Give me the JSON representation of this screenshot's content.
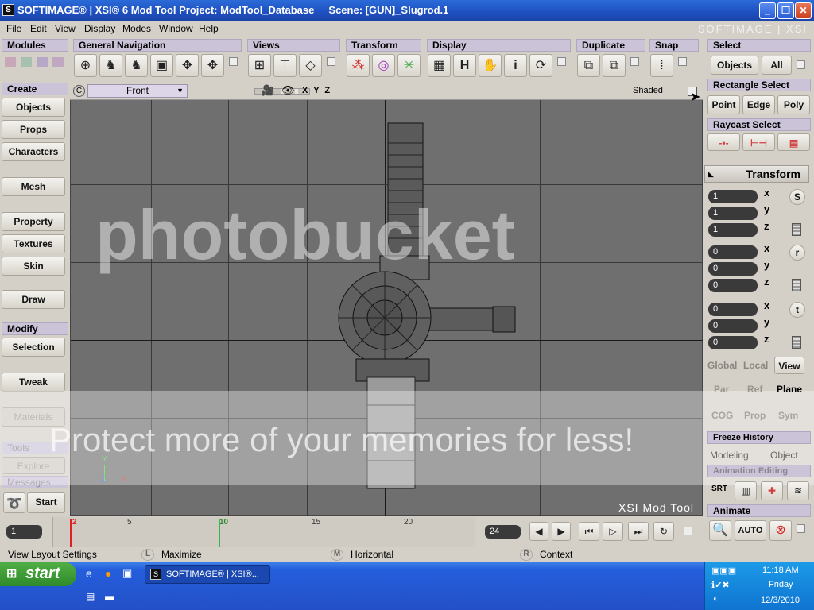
{
  "title_bar": {
    "title": "SOFTIMAGE® | XSI® 6 Mod Tool Project: ModTool_Database     Scene: [GUN]_Slugrod.1",
    "icon": "S"
  },
  "menu": {
    "items": [
      "File",
      "Edit",
      "View",
      "Display",
      "Modes",
      "Window",
      "Help"
    ],
    "brand": "SOFTIMAGE | XSI"
  },
  "toolbars": {
    "modules": "Modules",
    "general_navigation": "General Navigation",
    "views": "Views",
    "transform": "Transform",
    "display": "Display",
    "duplicate": "Duplicate",
    "snap": "Snap",
    "display_h": "H",
    "display_i": "i"
  },
  "left_panel": {
    "create": "Create",
    "objects": "Objects",
    "props": "Props",
    "characters": "Characters",
    "mesh": "Mesh",
    "property": "Property",
    "textures": "Textures",
    "skin": "Skin",
    "draw": "Draw",
    "modify": "Modify",
    "selection": "Selection",
    "tweak": "Tweak",
    "materials": "Materials",
    "tools": "Tools",
    "explore": "Explore",
    "messages": "Messages",
    "start": "Start"
  },
  "viewport": {
    "view_name": "Front",
    "axes": "X Y Z",
    "mode": "Shaded",
    "logo": "XSI Mod Tool",
    "gizmo_y": "Y",
    "gizmo_x": "X",
    "gizmo_z": "Z"
  },
  "watermark": {
    "brand": "photobucket",
    "message": "Protect more of your memories for less!"
  },
  "right_panel": {
    "select": "Select",
    "objects": "Objects",
    "all": "All",
    "rect_select": "Rectangle Select",
    "point": "Point",
    "edge": "Edge",
    "poly": "Poly",
    "raycast_select": "Raycast Select",
    "transform": "Transform",
    "scale": [
      "1",
      "1",
      "1"
    ],
    "rotate": [
      "0",
      "0",
      "0"
    ],
    "translate": [
      "0",
      "0",
      "0"
    ],
    "x": "x",
    "y": "y",
    "z": "z",
    "s": "S",
    "r": "r",
    "t": "t",
    "global": "Global",
    "local": "Local",
    "view": "View",
    "par": "Par",
    "ref": "Ref",
    "plane": "Plane",
    "cog": "COG",
    "prop": "Prop",
    "sym": "Sym",
    "freeze_history": "Freeze History",
    "modeling": "Modeling",
    "object": "Object",
    "animation_editing": "Animation Editing",
    "srt": "SRT",
    "animate": "Animate",
    "auto": "AUTO"
  },
  "timeline": {
    "start_frame": "1",
    "end_frame": "24",
    "current_frame": "2",
    "ticks": [
      "5",
      "10",
      "15",
      "20"
    ]
  },
  "status": {
    "left": "View Layout Settings",
    "l_key": "L",
    "l_action": "Maximize",
    "m_key": "M",
    "m_action": "Horizontal",
    "r_key": "R",
    "r_action": "Context"
  },
  "taskbar": {
    "start": "start",
    "task": "SOFTIMAGE® | XSI®...",
    "time": "11:18 AM",
    "day": "Friday",
    "date": "12/3/2010"
  }
}
